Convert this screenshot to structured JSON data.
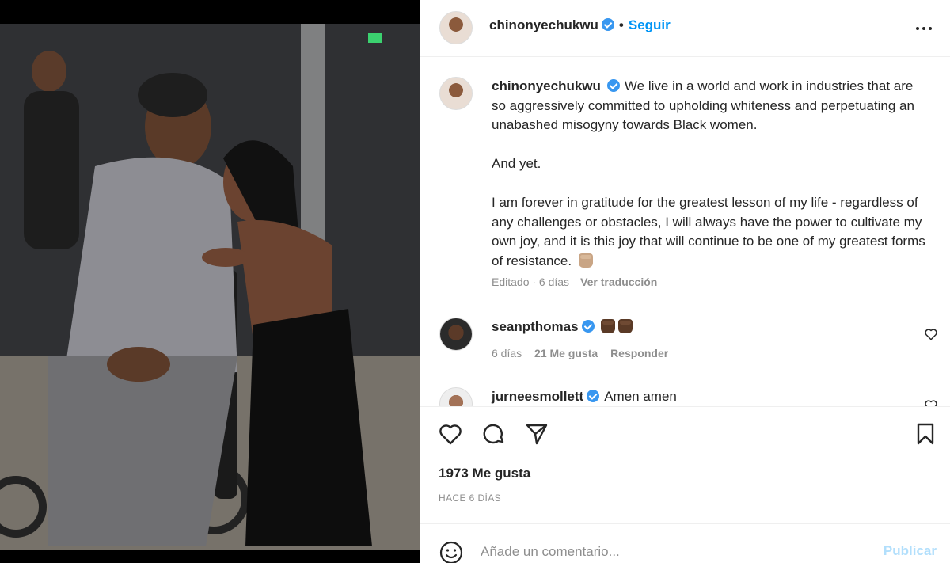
{
  "post": {
    "author": "chinonyechukwu",
    "follow_label": "Seguir",
    "separator": "•",
    "photo_alt": "two women smiling at each other"
  },
  "caption": {
    "username": "chinonyechukwu",
    "paragraph1": "We live in a world and work in industries that are so aggressively committed to upholding whiteness and perpetuating an unabashed misogyny towards Black women.",
    "paragraph2": "And yet.",
    "paragraph3": "I am forever in gratitude for the greatest lesson of my life - regardless of any challenges or obstacles, I will always have the power to cultivate my own joy, and it is this joy that will continue to be one of my greatest forms of resistance.",
    "edited": "Editado · 6 días",
    "translate": "Ver traducción"
  },
  "comments": [
    {
      "username": "seanpthomas",
      "text": "",
      "time": "6 días",
      "likes": "21 Me gusta",
      "reply": "Responder"
    },
    {
      "username": "jurneesmollett",
      "text": "Amen amen"
    }
  ],
  "actions": {
    "likes": "1973 Me gusta",
    "timestamp": "HACE 6 DÍAS"
  },
  "add_comment": {
    "placeholder": "Añade un comentario...",
    "publish": "Publicar"
  },
  "icons": [
    "more-icon",
    "verified-badge-icon",
    "heart-icon",
    "comment-icon",
    "share-icon",
    "bookmark-icon",
    "emoji-icon",
    "raised-fist-emoji"
  ],
  "colors": {
    "accent": "#0095f6",
    "verified": "#3897f0",
    "publish_disabled": "#b2dffc",
    "muted": "#8e8e8e"
  }
}
